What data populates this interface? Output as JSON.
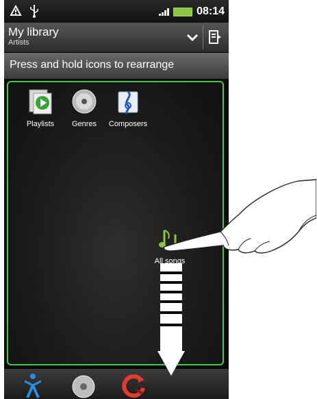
{
  "status_bar": {
    "time": "08:14"
  },
  "header": {
    "title": "My library",
    "subtitle": "Artists"
  },
  "hint": {
    "text": "Press and hold icons to rearrange"
  },
  "library_tiles": [
    {
      "label": "Playlists",
      "icon": "playlists-icon"
    },
    {
      "label": "Genres",
      "icon": "genres-icon"
    },
    {
      "label": "Composers",
      "icon": "composers-icon"
    }
  ],
  "dragged_tile": {
    "label": "All songs",
    "icon": "all-songs-icon"
  },
  "tab_bar": {
    "tabs": [
      {
        "icon": "artists-icon"
      },
      {
        "icon": "albums-icon"
      },
      {
        "icon": "recently-played-icon"
      }
    ]
  },
  "colors": {
    "highlight_border": "#47c84a",
    "battery": "#8dc63f",
    "accent_red": "#e53a2f"
  }
}
